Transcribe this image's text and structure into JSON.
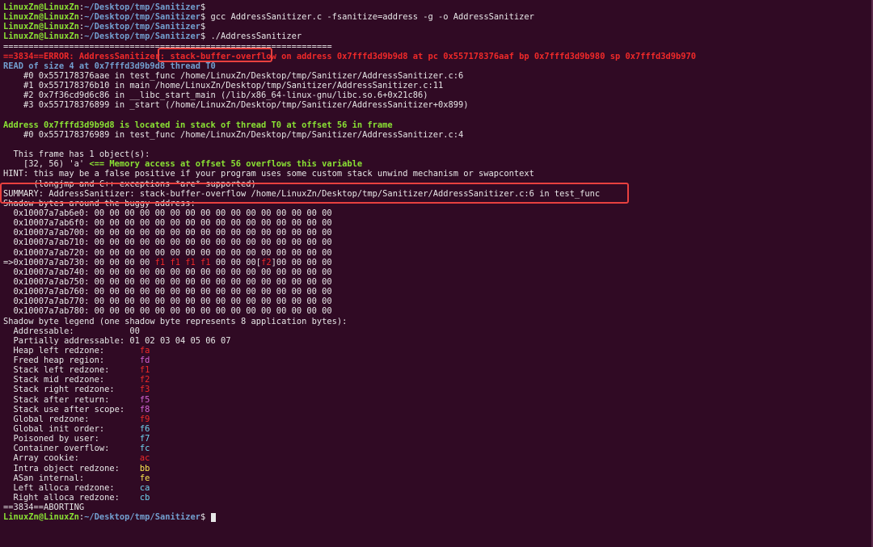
{
  "terminal": {
    "prompt_user": "LinuxZn@LinuxZn",
    "prompt_sep": ":",
    "prompt_dollar": "$",
    "path_sanitizer": "~/Desktop/tmp/Sanitizer",
    "cmd_gcc": " gcc AddressSanitizer.c -fsanitize=address -g -o AddressSanitizer",
    "cmd_run": " ./AddressSanitizer",
    "eq_line": "=================================================================",
    "error_prefix": "==3834==ERROR: AddressSanitizer: ",
    "error_kind": "stack-buffer-overflow",
    "error_suffix": " on address 0x7fffd3d9b9d8 at pc 0x557178376aaf bp 0x7fffd3d9b980 sp 0x7fffd3d9b970",
    "read_line": "READ of size 4 at 0x7fffd3d9b9d8 thread T0",
    "stack_frames": [
      "    #0 0x557178376aae in test_func /home/LinuxZn/Desktop/tmp/Sanitizer/AddressSanitizer.c:6",
      "    #1 0x557178376b10 in main /home/LinuxZn/Desktop/tmp/Sanitizer/AddressSanitizer.c:11",
      "    #2 0x7f36cd9d6c86 in __libc_start_main (/lib/x86_64-linux-gnu/libc.so.6+0x21c86)",
      "    #3 0x557178376899 in _start (/home/LinuxZn/Desktop/tmp/Sanitizer/AddressSanitizer+0x899)"
    ],
    "address_line": "Address 0x7fffd3d9b9d8 is located in stack of thread T0 at offset 56 in frame",
    "frame0_line": "    #0 0x557178376989 in test_func /home/LinuxZn/Desktop/tmp/Sanitizer/AddressSanitizer.c:4",
    "frame_objects": "  This frame has 1 object(s):",
    "object_prefix": "    [32, 56) 'a'",
    "object_note": " <== Memory access at offset 56 overflows this variable",
    "hint_line": "HINT: this may be a false positive if your program uses some custom stack unwind mechanism or swapcontext",
    "hint_line2": "      (longjmp and C++ exceptions *are* supported)",
    "summary_line": "SUMMARY: AddressSanitizer: stack-buffer-overflow /home/LinuxZn/Desktop/tmp/Sanitizer/AddressSanitizer.c:6 in test_func",
    "shadow_header": "Shadow bytes around the buggy address:",
    "shadow_rows": [
      "  0x10007a7ab6e0: 00 00 00 00 00 00 00 00 00 00 00 00 00 00 00 00",
      "  0x10007a7ab6f0: 00 00 00 00 00 00 00 00 00 00 00 00 00 00 00 00",
      "  0x10007a7ab700: 00 00 00 00 00 00 00 00 00 00 00 00 00 00 00 00",
      "  0x10007a7ab710: 00 00 00 00 00 00 00 00 00 00 00 00 00 00 00 00",
      "  0x10007a7ab720: 00 00 00 00 00 00 00 00 00 00 00 00 00 00 00 00"
    ],
    "buggy_row": {
      "prefix": "=>0x10007a7ab730: 00 00 00 00 ",
      "f1s": "f1 f1 f1 f1",
      "mid": " 00 00 00[",
      "f2": "f2",
      "suffix": "]00 00 00 00"
    },
    "shadow_rows_after": [
      "  0x10007a7ab740: 00 00 00 00 00 00 00 00 00 00 00 00 00 00 00 00",
      "  0x10007a7ab750: 00 00 00 00 00 00 00 00 00 00 00 00 00 00 00 00",
      "  0x10007a7ab760: 00 00 00 00 00 00 00 00 00 00 00 00 00 00 00 00",
      "  0x10007a7ab770: 00 00 00 00 00 00 00 00 00 00 00 00 00 00 00 00",
      "  0x10007a7ab780: 00 00 00 00 00 00 00 00 00 00 00 00 00 00 00 00"
    ],
    "legend_header": "Shadow byte legend (one shadow byte represents 8 application bytes):",
    "legend": [
      {
        "label": "  Addressable:           ",
        "code": "00",
        "color": "plain"
      },
      {
        "label": "  Partially addressable: ",
        "code": "01 02 03 04 05 06 07",
        "color": "plain"
      },
      {
        "label": "  Heap left redzone:       ",
        "code": "fa",
        "color": "red"
      },
      {
        "label": "  Freed heap region:       ",
        "code": "fd",
        "color": "mag"
      },
      {
        "label": "  Stack left redzone:      ",
        "code": "f1",
        "color": "red"
      },
      {
        "label": "  Stack mid redzone:       ",
        "code": "f2",
        "color": "red"
      },
      {
        "label": "  Stack right redzone:     ",
        "code": "f3",
        "color": "red"
      },
      {
        "label": "  Stack after return:      ",
        "code": "f5",
        "color": "mag"
      },
      {
        "label": "  Stack use after scope:   ",
        "code": "f8",
        "color": "mag"
      },
      {
        "label": "  Global redzone:          ",
        "code": "f9",
        "color": "red"
      },
      {
        "label": "  Global init order:       ",
        "code": "f6",
        "color": "cyn"
      },
      {
        "label": "  Poisoned by user:        ",
        "code": "f7",
        "color": "cyn"
      },
      {
        "label": "  Container overflow:      ",
        "code": "fc",
        "color": "cyn"
      },
      {
        "label": "  Array cookie:            ",
        "code": "ac",
        "color": "red"
      },
      {
        "label": "  Intra object redzone:    ",
        "code": "bb",
        "color": "yel"
      },
      {
        "label": "  ASan internal:           ",
        "code": "fe",
        "color": "yel"
      },
      {
        "label": "  Left alloca redzone:     ",
        "code": "ca",
        "color": "cyn"
      },
      {
        "label": "  Right alloca redzone:    ",
        "code": "cb",
        "color": "cyn"
      }
    ],
    "aborting_line": "==3834==ABORTING"
  }
}
